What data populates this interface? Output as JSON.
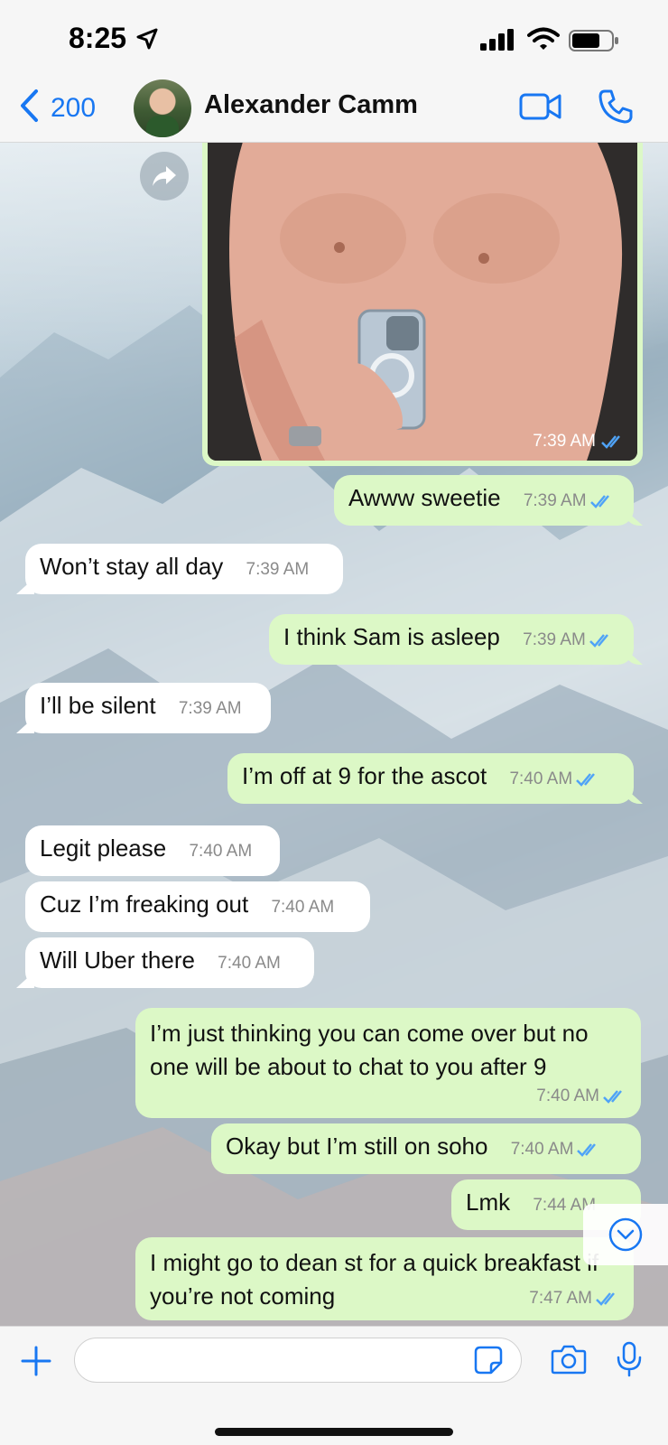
{
  "status_bar": {
    "time": "8:25"
  },
  "header": {
    "back_count": "200",
    "contact_name": "Alexander Camm"
  },
  "chat": {
    "photo_time": "7:39 AM",
    "messages": [
      {
        "dir": "out",
        "text": "Awww sweetie",
        "time": "7:39 AM"
      },
      {
        "dir": "in",
        "text": "Won’t stay all day",
        "time": "7:39 AM"
      },
      {
        "dir": "out",
        "text": "I think Sam is asleep",
        "time": "7:39 AM"
      },
      {
        "dir": "in",
        "text": "I’ll be silent",
        "time": "7:39 AM"
      },
      {
        "dir": "out",
        "text": "I’m off at 9 for the ascot",
        "time": "7:40 AM"
      },
      {
        "dir": "in",
        "text": "Legit please",
        "time": "7:40 AM"
      },
      {
        "dir": "in",
        "text": "Cuz I’m freaking out",
        "time": "7:40 AM"
      },
      {
        "dir": "in",
        "text": "Will Uber there",
        "time": "7:40 AM"
      },
      {
        "dir": "out",
        "text": "I’m just thinking you can come over but no one will be about to chat to you after 9",
        "time": "7:40 AM"
      },
      {
        "dir": "out",
        "text": "Okay but I’m still on soho",
        "time": "7:40 AM"
      },
      {
        "dir": "out",
        "text": "Lmk",
        "time": "7:44 AM"
      },
      {
        "dir": "out",
        "text": "I might go to dean st for a quick breakfast if you’re not coming",
        "time": "7:47 AM"
      }
    ]
  },
  "composer": {
    "placeholder": ""
  },
  "colors": {
    "accent": "#1877f2",
    "outgoing_bubble": "#dcf8c6",
    "incoming_bubble": "#ffffff",
    "read_ticks": "#4fa3f7"
  }
}
